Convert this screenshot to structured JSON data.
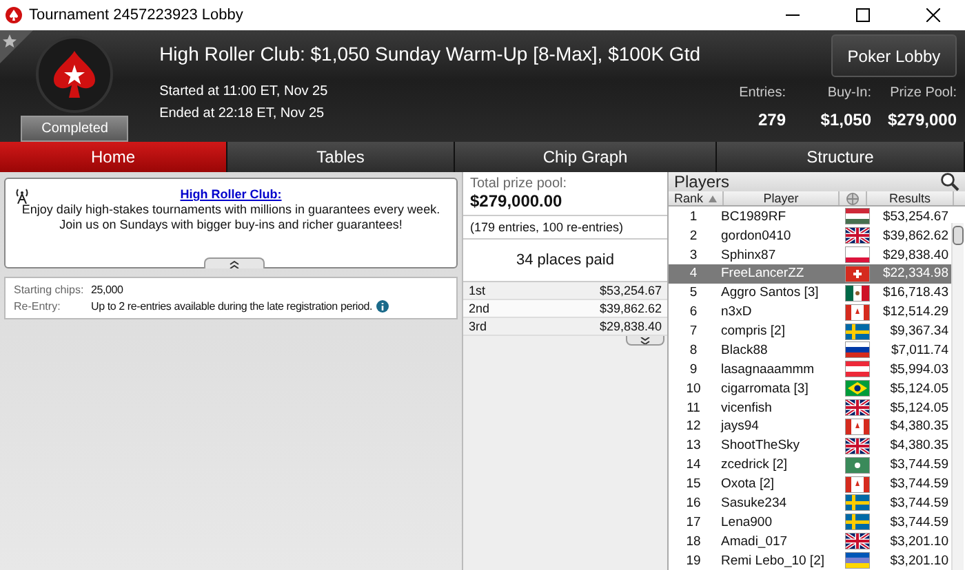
{
  "window": {
    "title": "Tournament 2457223923 Lobby"
  },
  "header": {
    "title": "High Roller Club: $1,050 Sunday Warm-Up [8-Max], $100K Gtd",
    "status": "Completed",
    "started": "Started at 11:00 ET, Nov 25",
    "ended": "Ended at 22:18 ET, Nov 25",
    "lobby_button": "Poker Lobby",
    "stats": [
      {
        "label": "Entries:",
        "value": "279"
      },
      {
        "label": "Buy-In:",
        "value": "$1,050"
      },
      {
        "label": "Prize Pool:",
        "value": "$279,000"
      }
    ]
  },
  "tabs": [
    {
      "label": "Home",
      "selected": true
    },
    {
      "label": "Tables",
      "selected": false
    },
    {
      "label": "Chip Graph",
      "selected": false
    },
    {
      "label": "Structure",
      "selected": false
    }
  ],
  "promo": {
    "link": "High Roller Club:",
    "lines": [
      "Enjoy daily high-stakes tournaments with millions in guarantees every week.",
      "Join us on Sundays with bigger buy-ins and richer guarantees!"
    ]
  },
  "details": [
    {
      "label": "Starting chips:",
      "value": "25,000"
    },
    {
      "label": "Re-Entry:",
      "value": "Up to 2 re-entries available during the late registration period."
    }
  ],
  "prizes": {
    "label": "Total prize pool:",
    "amount": "$279,000.00",
    "entries": "(179 entries, 100 re-entries)",
    "places": "34 places paid",
    "rows": [
      {
        "place": "1st",
        "amount": "$53,254.67"
      },
      {
        "place": "2nd",
        "amount": "$39,862.62"
      },
      {
        "place": "3rd",
        "amount": "$29,838.40"
      }
    ]
  },
  "players": {
    "title": "Players",
    "columns": [
      "Rank",
      "Player",
      "Results"
    ],
    "rows": [
      {
        "rank": "1",
        "player": "BC1989RF",
        "kind": "hu",
        "result": "$53,254.67",
        "selected": false
      },
      {
        "rank": "2",
        "player": "gordon0410",
        "kind": "gb",
        "result": "$39,862.62",
        "selected": false
      },
      {
        "rank": "3",
        "player": "Sphinx87",
        "kind": "pl",
        "result": "$29,838.40",
        "selected": false
      },
      {
        "rank": "4",
        "player": "FreeLancerZZ",
        "kind": "ch",
        "result": "$22,334.98",
        "selected": true
      },
      {
        "rank": "5",
        "player": "Aggro Santos [3]",
        "kind": "mx",
        "result": "$16,718.43",
        "selected": false
      },
      {
        "rank": "6",
        "player": "n3xD",
        "kind": "ca",
        "result": "$12,514.29",
        "selected": false
      },
      {
        "rank": "7",
        "player": "compris [2]",
        "kind": "se",
        "result": "$9,367.34",
        "selected": false
      },
      {
        "rank": "8",
        "player": "Black88",
        "kind": "ru",
        "result": "$7,011.74",
        "selected": false
      },
      {
        "rank": "9",
        "player": "lasagnaaammm",
        "kind": "at",
        "result": "$5,994.03",
        "selected": false
      },
      {
        "rank": "10",
        "player": "cigarromata [3]",
        "kind": "br",
        "result": "$5,124.05",
        "selected": false
      },
      {
        "rank": "11",
        "player": "vicenfish",
        "kind": "gb",
        "result": "$5,124.05",
        "selected": false
      },
      {
        "rank": "12",
        "player": "jays94",
        "kind": "ca",
        "result": "$4,380.35",
        "selected": false
      },
      {
        "rank": "13",
        "player": "ShootTheSky",
        "kind": "gb",
        "result": "$4,380.35",
        "selected": false
      },
      {
        "rank": "14",
        "player": "zcedrick [2]",
        "kind": "generic",
        "result": "$3,744.59",
        "selected": false
      },
      {
        "rank": "15",
        "player": "Oxota [2]",
        "kind": "ca",
        "result": "$3,744.59",
        "selected": false
      },
      {
        "rank": "16",
        "player": "Sasuke234",
        "kind": "se",
        "result": "$3,744.59",
        "selected": false
      },
      {
        "rank": "17",
        "player": "Lena900",
        "kind": "se",
        "result": "$3,744.59",
        "selected": false
      },
      {
        "rank": "18",
        "player": "Amadi_017",
        "kind": "gb",
        "result": "$3,201.10",
        "selected": false
      },
      {
        "rank": "19",
        "player": "Remi Lebo_10 [2]",
        "kind": "ua",
        "result": "$3,201.10",
        "selected": false
      }
    ]
  }
}
